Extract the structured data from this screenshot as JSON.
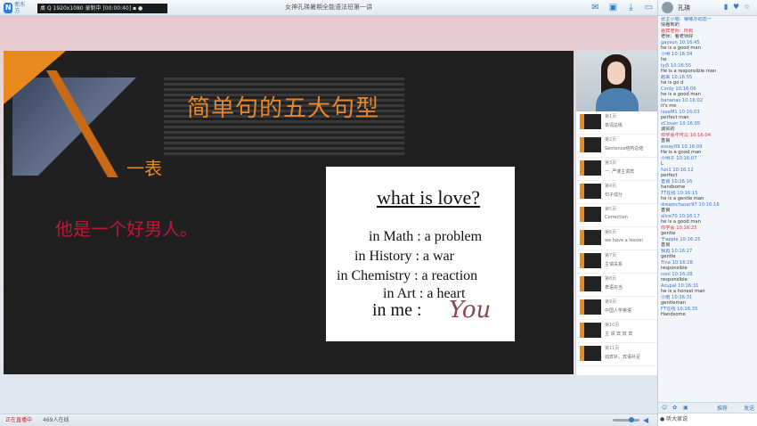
{
  "app": {
    "logo_text": "新东方",
    "recording_bar": "桌 Q 1920x1080  录制中 [00:00:40]  ▪ ●",
    "window_title": "女神孔瑛暑期全能语法班第一讲",
    "top_icons": [
      "mail-icon",
      "camera-icon",
      "download-icon",
      "window-icon"
    ]
  },
  "slide": {
    "title": "简单句的五大句型",
    "partial_char": "一表",
    "sentence": "他是一个好男人。",
    "card": {
      "question": "what is love?",
      "lines": [
        {
          "label": "in Math",
          "answer": ": a problem"
        },
        {
          "label": "in History",
          "answer": ": a war"
        },
        {
          "label": "in Chemistry",
          "answer": ": a reaction"
        },
        {
          "label": "in Art",
          "answer": ": a heart"
        }
      ],
      "me_label": "in me :",
      "you_word": "You"
    }
  },
  "thumbnails": [
    {
      "num": "第1页",
      "label": "单词总练"
    },
    {
      "num": "第2页",
      "label": "Sentence结构总结"
    },
    {
      "num": "第3页",
      "label": "一. 严谨主谓宾"
    },
    {
      "num": "第4页",
      "label": "句子成分"
    },
    {
      "num": "第5页",
      "label": "Correction"
    },
    {
      "num": "第6页",
      "label": "we have a lesson"
    },
    {
      "num": "第7页",
      "label": "主谓关系"
    },
    {
      "num": "第8页",
      "label": "表语充当"
    },
    {
      "num": "第9页",
      "label": "中国人学英语"
    },
    {
      "num": "第10页",
      "label": "主 谓 宾 双 宾"
    },
    {
      "num": "第11页",
      "label": "动宾补，宾语补足"
    }
  ],
  "status": {
    "live": "正在直播中",
    "online": "469人在线"
  },
  "chat": {
    "header_name": "孔瑛",
    "messages": [
      {
        "who": "张主小喵：哪哪办动态一",
        "text": "情看到的",
        "red": false
      },
      {
        "who": "嘉宾老师：所有",
        "text": "老师：看老师好",
        "red": true
      },
      {
        "who": "gaysun 10:16:45",
        "text": "he is a good man",
        "red": false
      },
      {
        "who": "小明 10:16:34",
        "text": "he",
        "red": false
      },
      {
        "who": "lyj5 10:16:55",
        "text": "He is a responsible man",
        "red": false
      },
      {
        "who": "越来 10:16:55",
        "text": "he is go d",
        "red": false
      },
      {
        "who": "Cindy 10:16:06",
        "text": "he is a good man",
        "red": false
      },
      {
        "who": "bananas 10:16:02",
        "text": "it's me",
        "red": false
      },
      {
        "who": "loveM1 10:16:03",
        "text": "perfect man",
        "red": false
      },
      {
        "who": "zClover 10:16:05",
        "text": "诚实的",
        "red": false
      },
      {
        "who": "你学会不可以 10:16:04",
        "text": "善良",
        "red": true
      },
      {
        "who": "essay09 10:16:09",
        "text": "He is a good man",
        "red": false
      },
      {
        "who": "小明子 10:16:07",
        "text": "L",
        "red": false
      },
      {
        "who": "fun1 10:16:12",
        "text": "perfect",
        "red": false
      },
      {
        "who": "善良 10:16:16",
        "text": "handsome",
        "red": false
      },
      {
        "who": "TT在线 10:16:15",
        "text": "he is a gentle man",
        "red": false
      },
      {
        "who": "dreamchaser97 10:16:16",
        "text": "善良",
        "red": false
      },
      {
        "who": "alice70 10:16:17",
        "text": "he is a good man",
        "red": false
      },
      {
        "who": "你学会 10:16:25",
        "text": "gentle",
        "red": true
      },
      {
        "who": "于apple 10:16:25",
        "text": "善良",
        "red": false
      },
      {
        "who": "我再 10:16:27",
        "text": "gentle",
        "red": false
      },
      {
        "who": "Tina 10:16:28",
        "text": "responsible",
        "red": false
      },
      {
        "who": "cool 10:16:28",
        "text": "responsible",
        "red": false
      },
      {
        "who": "Acupal 10:16:31",
        "text": "he is a honest man",
        "red": false
      },
      {
        "who": "小雨 10:16:31",
        "text": "gentleman",
        "red": false
      },
      {
        "who": "FT在线 10:16:35",
        "text": "Handsome",
        "red": false
      }
    ],
    "tools": [
      "emoji-icon",
      "flower-icon",
      "image-icon"
    ],
    "send_label": "发送",
    "recommend_label": "推荐",
    "input_text": "● 听大家说"
  }
}
